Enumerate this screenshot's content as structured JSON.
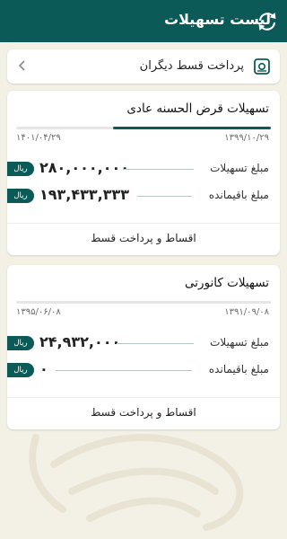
{
  "header": {
    "title": "لیست تسهیلات",
    "refresh_icon": "refresh-icon",
    "background": "#0b5a57"
  },
  "other_payment": {
    "label": "پرداخت قسط دیگران",
    "icon": "document-payment-icon",
    "chevron": "chevron-left-icon"
  },
  "loans": [
    {
      "title": "تسهیلات قرض الحسنه عادی",
      "start_date": "۱۳۹۹/۱۰/۲۹",
      "end_date": "۱۴۰۱/۰۴/۲۹",
      "progress": 0.62,
      "facility_label": "مبلغ تسهیلات",
      "facility_amount": "۲۸۰,۰۰۰,۰۰۰",
      "remaining_label": "مبلغ باقیمانده",
      "remaining_amount": "۱۹۳,۴۳۳,۳۳۳",
      "currency": "ریال",
      "action_label": "اقساط و پرداخت قسط"
    },
    {
      "title": "تسهیلات کانورتی",
      "start_date": "۱۳۹۱/۰۹/۰۸",
      "end_date": "۱۳۹۵/۰۶/۰۸",
      "progress": 0,
      "facility_label": "مبلغ تسهیلات",
      "facility_amount": "۲۴,۹۳۲,۰۰۰",
      "remaining_label": "مبلغ باقیمانده",
      "remaining_amount": "۰",
      "currency": "ریال",
      "action_label": "اقساط و پرداخت قسط"
    }
  ]
}
